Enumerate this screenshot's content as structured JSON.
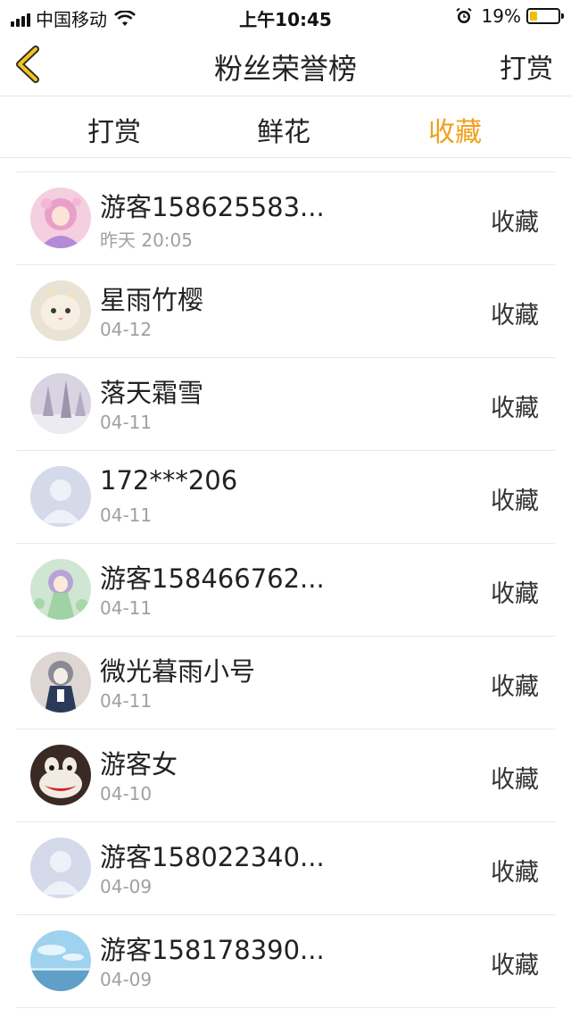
{
  "status_bar": {
    "carrier": "中国移动",
    "time": "上午10:45",
    "battery": "19%"
  },
  "nav": {
    "title": "粉丝荣誉榜",
    "action": "打赏"
  },
  "tabs": [
    {
      "label": "打赏",
      "active": false
    },
    {
      "label": "鲜花",
      "active": false
    },
    {
      "label": "收藏",
      "active": true
    }
  ],
  "colors": {
    "accent": "#f0a01e",
    "battery": "#f0c000"
  },
  "fans": [
    {
      "name": "游客158625583...",
      "date": "昨天 20:05",
      "tag": "收藏",
      "avatar": "anime-girl-pink-icon"
    },
    {
      "name": "星雨竹樱",
      "date": "04-12",
      "tag": "收藏",
      "avatar": "kitten-icon"
    },
    {
      "name": "落天霜雪",
      "date": "04-11",
      "tag": "收藏",
      "avatar": "snowy-trees-icon"
    },
    {
      "name": "172***206",
      "date": "04-11",
      "tag": "收藏",
      "avatar": "default-user-icon"
    },
    {
      "name": "游客158466762...",
      "date": "04-11",
      "tag": "收藏",
      "avatar": "anime-girl-green-icon"
    },
    {
      "name": "微光暮雨小号",
      "date": "04-11",
      "tag": "收藏",
      "avatar": "anime-girl-dark-icon"
    },
    {
      "name": "游客女",
      "date": "04-10",
      "tag": "收藏",
      "avatar": "monkey-face-icon"
    },
    {
      "name": "游客158022340...",
      "date": "04-09",
      "tag": "收藏",
      "avatar": "default-user-icon"
    },
    {
      "name": "游客158178390...",
      "date": "04-09",
      "tag": "收藏",
      "avatar": "sky-landscape-icon"
    }
  ]
}
